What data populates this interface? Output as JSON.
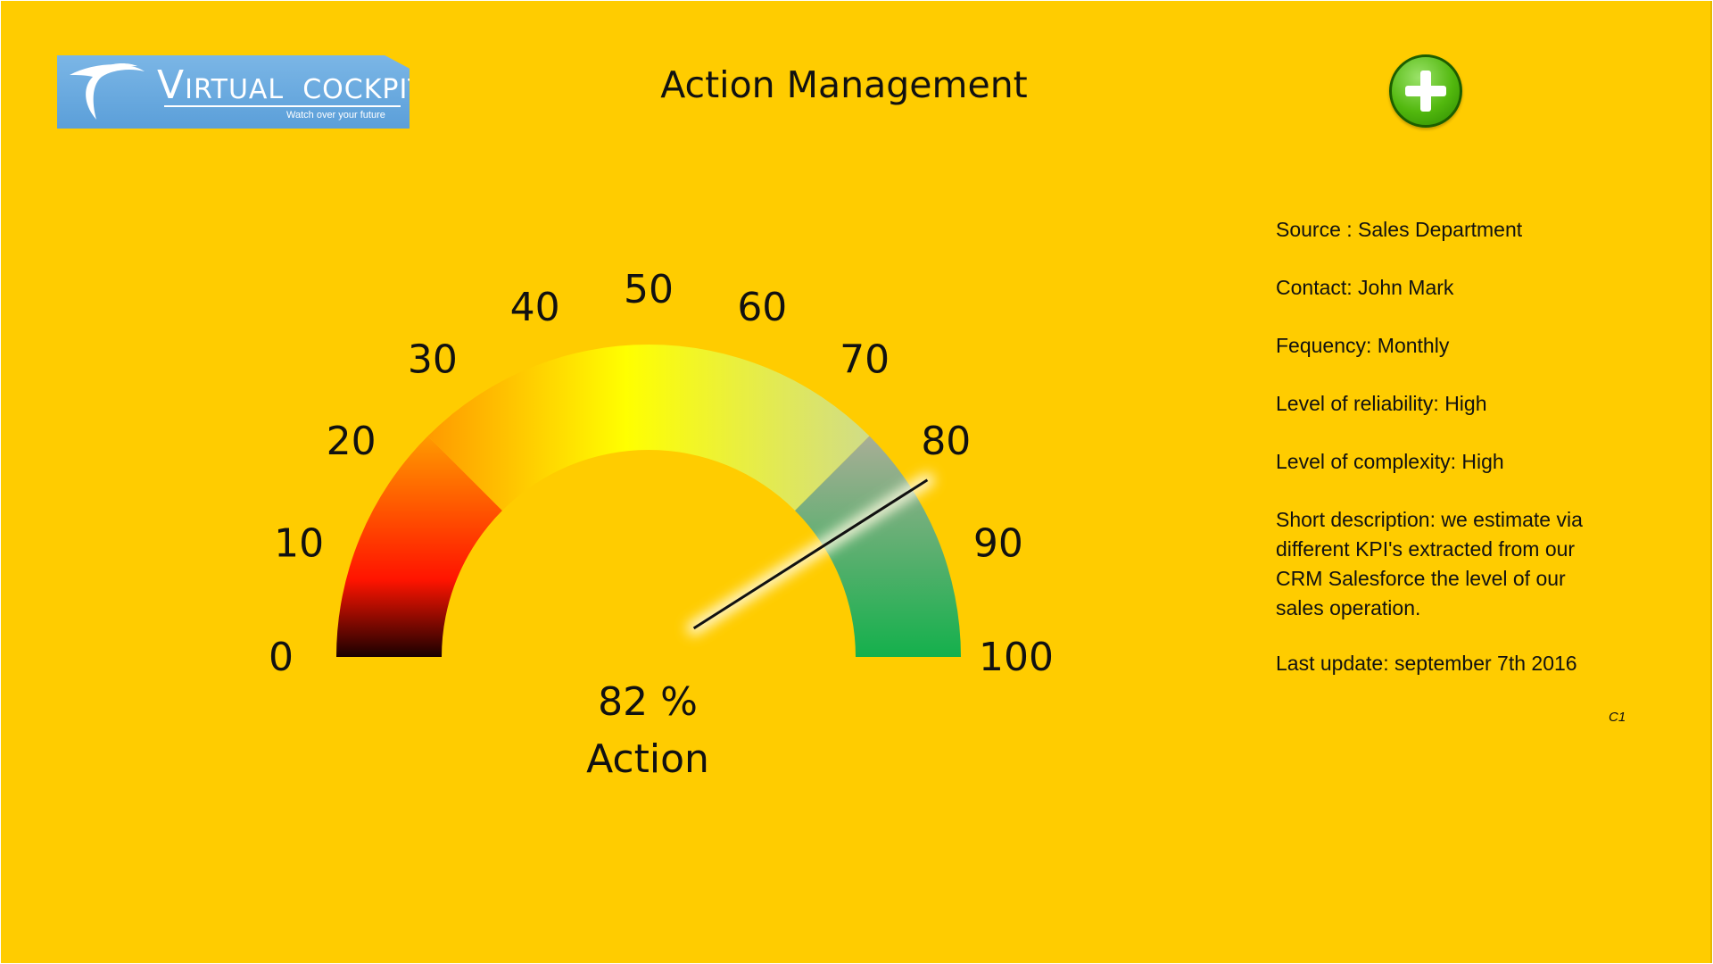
{
  "header": {
    "title": "Action Management",
    "add_button_icon": "plus-circle-icon"
  },
  "logo": {
    "first_letter": "V",
    "rest_first": "IRTUAL",
    "second": "COCKPIT",
    "tagline": "Watch over your future",
    "icon": "bird-mark-icon"
  },
  "gauge": {
    "min": 0,
    "max": 100,
    "value": 82,
    "ticks": [
      "0",
      "10",
      "20",
      "30",
      "40",
      "50",
      "60",
      "70",
      "80",
      "90",
      "100"
    ],
    "readout": "82 %",
    "label": "Action",
    "colors": {
      "low": "#1a0000",
      "mid_low": "#ff3000",
      "orange": "#ff8c00",
      "yellow": "#ffff00",
      "pale": "#d4e08a",
      "gray": "#a8ae95",
      "green": "#14b04c",
      "needle": "#111111"
    }
  },
  "info": {
    "source": "Source : Sales Department",
    "contact": "Contact: John Mark",
    "frequency": "Fequency: Monthly",
    "reliability": "Level of reliability: High",
    "complexity": "Level of complexity: High",
    "description_lines": [
      "Short description: we estimate via",
      "different KPI's extracted from our",
      "CRM Salesforce the level of our",
      "sales operation."
    ],
    "last_update": "Last update:  september 7th 2016",
    "code": "C1"
  }
}
